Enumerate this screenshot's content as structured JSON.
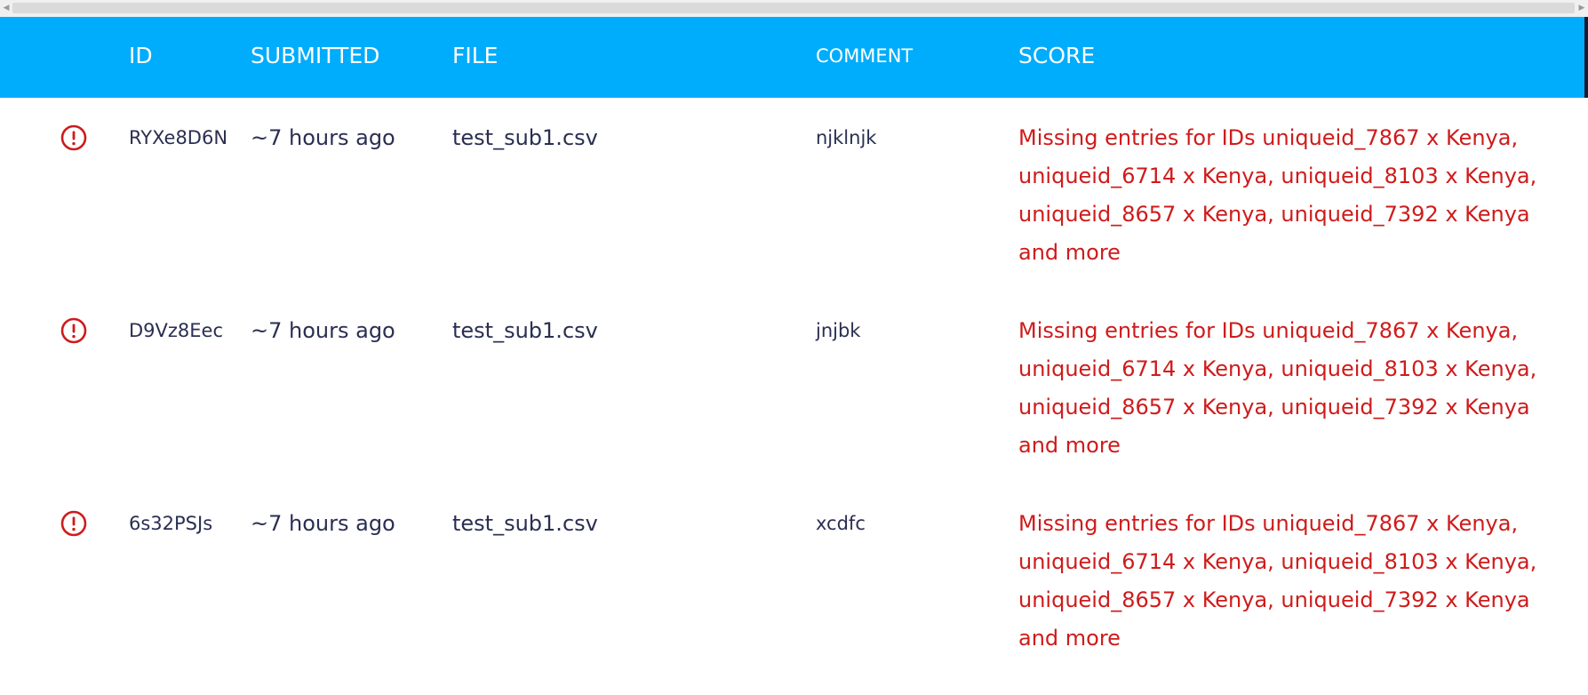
{
  "scrollbar": {
    "left_arrow": "◀",
    "right_arrow": "▶"
  },
  "table": {
    "columns": {
      "id": "ID",
      "submitted": "SUBMITTED",
      "file": "FILE",
      "comment": "COMMENT",
      "score": "SCORE"
    },
    "rows": [
      {
        "status_icon": "error-circle-icon",
        "id": "RYXe8D6N",
        "submitted": "~7 hours ago",
        "file": "test_sub1.csv",
        "comment": "njklnjk",
        "score": "Missing entries for IDs uniqueid_7867 x Kenya, uniqueid_6714 x Kenya, uniqueid_8103 x Kenya, uniqueid_8657 x Kenya, uniqueid_7392 x Kenya and more"
      },
      {
        "status_icon": "error-circle-icon",
        "id": "D9Vz8Eec",
        "submitted": "~7 hours ago",
        "file": "test_sub1.csv",
        "comment": "jnjbk",
        "score": "Missing entries for IDs uniqueid_7867 x Kenya, uniqueid_6714 x Kenya, uniqueid_8103 x Kenya, uniqueid_8657 x Kenya, uniqueid_7392 x Kenya and more"
      },
      {
        "status_icon": "error-circle-icon",
        "id": "6s32PSJs",
        "submitted": "~7 hours ago",
        "file": "test_sub1.csv",
        "comment": "xcdfc",
        "score": "Missing entries for IDs uniqueid_7867 x Kenya, uniqueid_6714 x Kenya, uniqueid_8103 x Kenya, uniqueid_8657 x Kenya, uniqueid_7392 x Kenya and more"
      }
    ]
  },
  "colors": {
    "header_bg": "#00acfc",
    "header_text": "#ffffff",
    "body_text": "#2a2f52",
    "error": "#cf1b1b"
  }
}
